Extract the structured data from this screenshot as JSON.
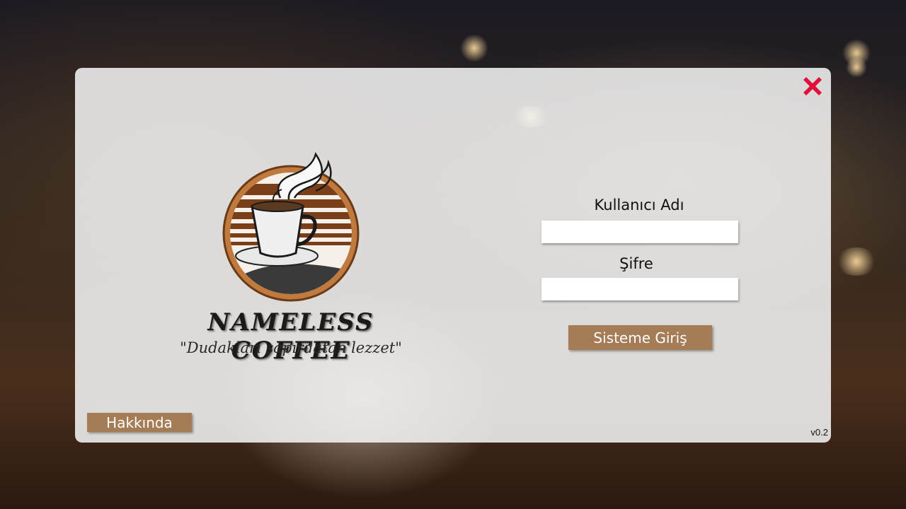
{
  "close": {
    "icon": "close-icon"
  },
  "logo": {
    "icon": "coffee-cup-icon",
    "brand": "NAMELESS COFFEE",
    "slogan": "\"Dudakları şapırdatan lezzet\""
  },
  "login": {
    "username_label": "Kullanıcı Adı",
    "username_value": "",
    "password_label": "Şifre",
    "password_value": "",
    "submit_label": "Sisteme Giriş"
  },
  "footer": {
    "about_label": "Hakkında",
    "version": "v0.2"
  },
  "colors": {
    "accent": "#a57c55",
    "close": "#e0103a",
    "panel": "#f2f2f2"
  }
}
